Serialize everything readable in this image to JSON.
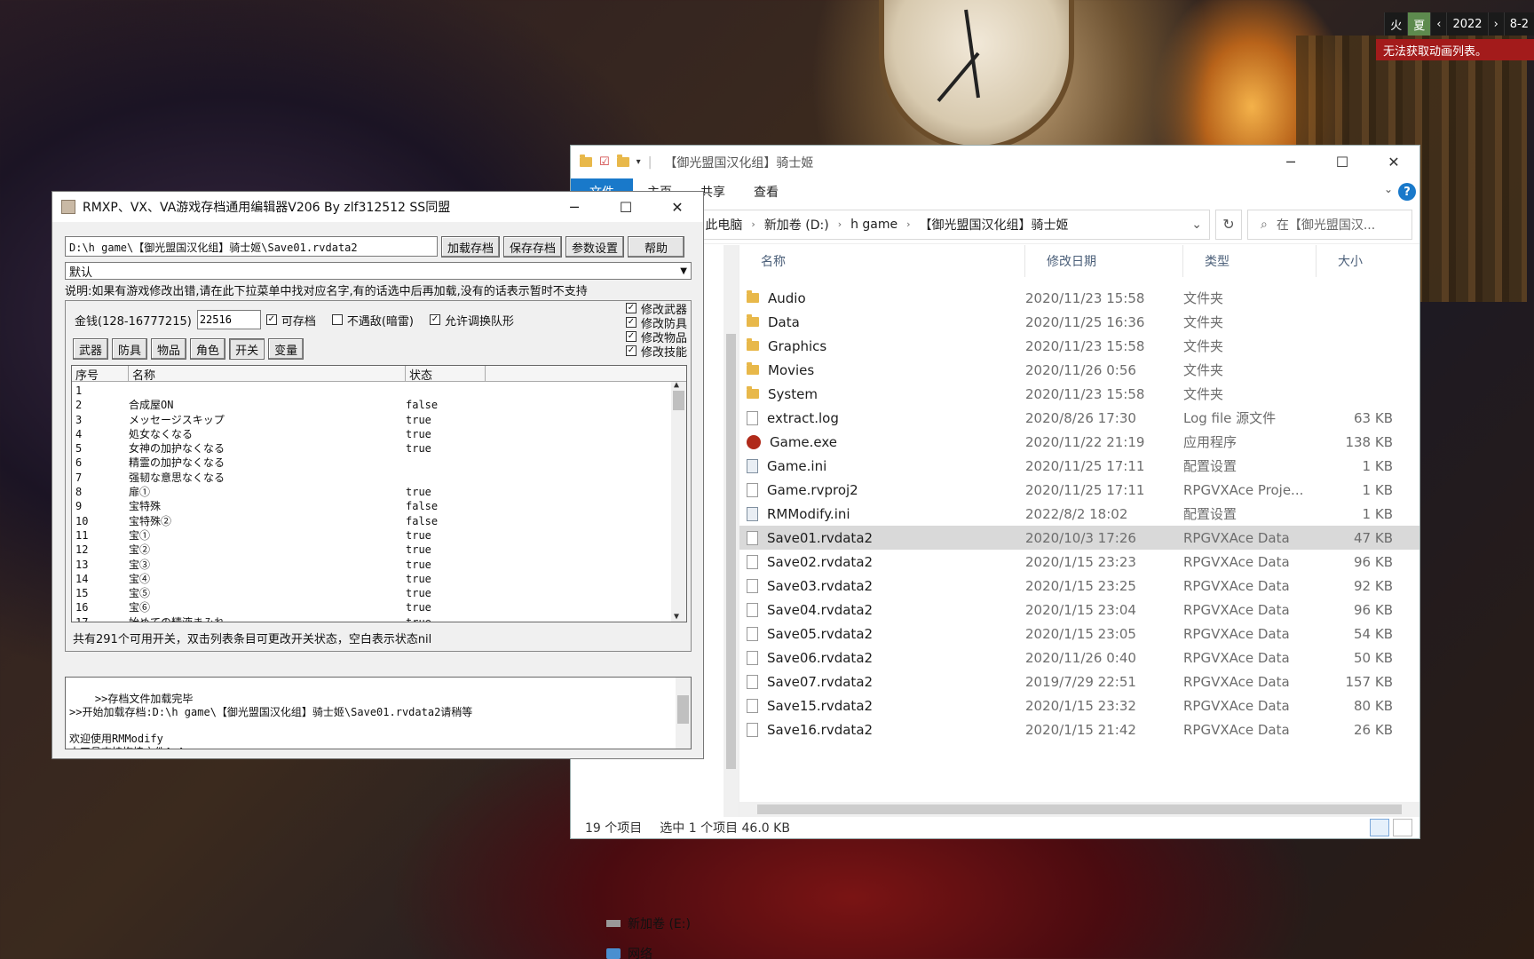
{
  "tray": {
    "cells": [
      "火",
      "夏",
      "‹",
      "2022",
      "›",
      "8-2"
    ],
    "message": "无法获取动画列表。"
  },
  "explorer": {
    "title": "【御光盟国汉化组】骑士姬",
    "ribbon_tabs": [
      "文件",
      "主页",
      "共享",
      "查看"
    ],
    "address": [
      "此电脑",
      "新加卷 (D:)",
      "h game",
      "【御光盟国汉化组】骑士姬"
    ],
    "search_placeholder": "在【御光盟国汉...",
    "columns": [
      "名称",
      "修改日期",
      "类型",
      "大小"
    ],
    "files": [
      {
        "name": "Audio",
        "date": "2020/11/23 15:58",
        "type": "文件夹",
        "size": "",
        "icon": "folder"
      },
      {
        "name": "Data",
        "date": "2020/11/25 16:36",
        "type": "文件夹",
        "size": "",
        "icon": "folder"
      },
      {
        "name": "Graphics",
        "date": "2020/11/23 15:58",
        "type": "文件夹",
        "size": "",
        "icon": "folder"
      },
      {
        "name": "Movies",
        "date": "2020/11/26 0:56",
        "type": "文件夹",
        "size": "",
        "icon": "folder"
      },
      {
        "name": "System",
        "date": "2020/11/23 15:58",
        "type": "文件夹",
        "size": "",
        "icon": "folder"
      },
      {
        "name": "extract.log",
        "date": "2020/8/26 17:30",
        "type": "Log file 源文件",
        "size": "63 KB",
        "icon": "file"
      },
      {
        "name": "Game.exe",
        "date": "2020/11/22 21:19",
        "type": "应用程序",
        "size": "138 KB",
        "icon": "exe"
      },
      {
        "name": "Game.ini",
        "date": "2020/11/25 17:11",
        "type": "配置设置",
        "size": "1 KB",
        "icon": "ini"
      },
      {
        "name": "Game.rvproj2",
        "date": "2020/11/25 17:11",
        "type": "RPGVXAce Proje...",
        "size": "1 KB",
        "icon": "file"
      },
      {
        "name": "RMModify.ini",
        "date": "2022/8/2 18:02",
        "type": "配置设置",
        "size": "1 KB",
        "icon": "ini"
      },
      {
        "name": "Save01.rvdata2",
        "date": "2020/10/3 17:26",
        "type": "RPGVXAce Data",
        "size": "47 KB",
        "icon": "file",
        "selected": true
      },
      {
        "name": "Save02.rvdata2",
        "date": "2020/1/15 23:23",
        "type": "RPGVXAce Data",
        "size": "96 KB",
        "icon": "file"
      },
      {
        "name": "Save03.rvdata2",
        "date": "2020/1/15 23:25",
        "type": "RPGVXAce Data",
        "size": "92 KB",
        "icon": "file"
      },
      {
        "name": "Save04.rvdata2",
        "date": "2020/1/15 23:04",
        "type": "RPGVXAce Data",
        "size": "96 KB",
        "icon": "file"
      },
      {
        "name": "Save05.rvdata2",
        "date": "2020/1/15 23:05",
        "type": "RPGVXAce Data",
        "size": "54 KB",
        "icon": "file"
      },
      {
        "name": "Save06.rvdata2",
        "date": "2020/11/26 0:40",
        "type": "RPGVXAce Data",
        "size": "50 KB",
        "icon": "file"
      },
      {
        "name": "Save07.rvdata2",
        "date": "2019/7/29 22:51",
        "type": "RPGVXAce Data",
        "size": "157 KB",
        "icon": "file"
      },
      {
        "name": "Save15.rvdata2",
        "date": "2020/1/15 23:32",
        "type": "RPGVXAce Data",
        "size": "80 KB",
        "icon": "file"
      },
      {
        "name": "Save16.rvdata2",
        "date": "2020/1/15 21:42",
        "type": "RPGVXAce Data",
        "size": "26 KB",
        "icon": "file"
      }
    ],
    "nav_items": [
      "新加卷 (E:)",
      "网络"
    ],
    "status_count": "19 个项目",
    "status_selected": "选中 1 个项目  46.0 KB"
  },
  "rm": {
    "title": "RMXP、VX、VA游戏存档通用编辑器V206 By zlf312512 SS同盟",
    "path": "D:\\h game\\【御光盟国汉化组】骑士姬\\Save01.rvdata2",
    "buttons": [
      "加载存档",
      "保存存档",
      "参数设置",
      "帮助"
    ],
    "select_value": "默认",
    "note": "说明:如果有游戏修改出错,请在此下拉菜单中找对应名字,有的话选中后再加载,没有的话表示暂时不支持",
    "gold_label": "金钱(128-16777215)",
    "gold_value": "22516",
    "options": [
      {
        "label": "可存档",
        "checked": true
      },
      {
        "label": "不遇敌(暗雷)",
        "checked": false
      },
      {
        "label": "允许调换队形",
        "checked": true
      }
    ],
    "modify_options": [
      {
        "label": "修改武器",
        "checked": true
      },
      {
        "label": "修改防具",
        "checked": true
      },
      {
        "label": "修改物品",
        "checked": true
      },
      {
        "label": "修改技能",
        "checked": true
      }
    ],
    "tabs": [
      "武器",
      "防具",
      "物品",
      "角色",
      "开关",
      "变量"
    ],
    "table_headers": [
      "序号",
      "名称",
      "状态"
    ],
    "table_rows": [
      [
        "1",
        "",
        ""
      ],
      [
        "2",
        "合成屋ON",
        "false"
      ],
      [
        "3",
        "メッセージスキップ",
        "true"
      ],
      [
        "4",
        "処女なくなる",
        "true"
      ],
      [
        "5",
        "女神の加护なくなる",
        "true"
      ],
      [
        "6",
        "精霊の加护なくなる",
        ""
      ],
      [
        "7",
        "强韧な意思なくなる",
        ""
      ],
      [
        "8",
        "扉①",
        "true"
      ],
      [
        "9",
        "宝特殊",
        "false"
      ],
      [
        "10",
        "宝特殊②",
        "false"
      ],
      [
        "11",
        "宝①",
        "true"
      ],
      [
        "12",
        "宝②",
        "true"
      ],
      [
        "13",
        "宝③",
        "true"
      ],
      [
        "14",
        "宝④",
        "true"
      ],
      [
        "15",
        "宝⑤",
        "true"
      ],
      [
        "16",
        "宝⑥",
        "true"
      ],
      [
        "17",
        "始めての精液まみれ",
        "true"
      ]
    ],
    "count_text": "共有291个可用开关，双击列表条目可更改开关状态，空白表示状态nil",
    "log": ">>存档文件加载完毕\n>>开始加载存档:D:\\h game\\【御光盟国汉化组】骑士姬\\Save01.rvdata2请稍等\n\n欢迎使用RMModify\n本工具支持拖拽文件^_^"
  }
}
